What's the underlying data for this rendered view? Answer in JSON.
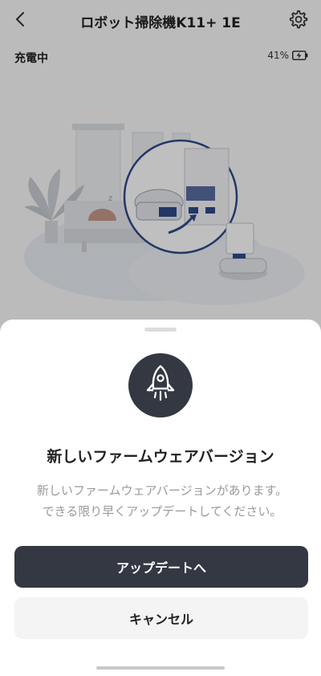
{
  "header": {
    "title": "ロボット掃除機K11+ 1E",
    "back_icon": "chevron-left-icon",
    "settings_icon": "gear-icon"
  },
  "status": {
    "text": "充電中",
    "battery_percent": "41%",
    "battery_icon": "battery-charging-icon"
  },
  "dialog": {
    "icon": "rocket-icon",
    "title": "新しいファームウェアバージョン",
    "message_line1": "新しいファームウェアバージョンがあります。",
    "message_line2": "できる限り早くアップデートしてください。",
    "primary_label": "アップデートへ",
    "secondary_label": "キャンセル"
  },
  "colors": {
    "dark": "#343842",
    "accent_blue": "#2f4a8a"
  }
}
